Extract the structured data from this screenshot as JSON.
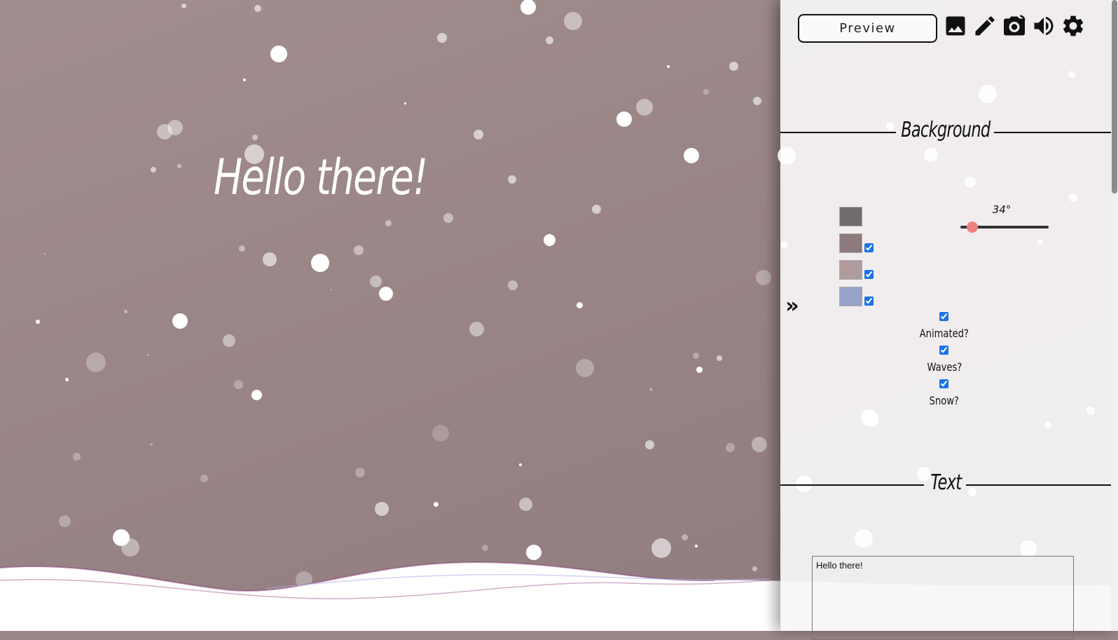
{
  "stage": {
    "greeting": "Hello there!"
  },
  "toolbar": {
    "preview_label": "Preview",
    "icons": [
      "image-icon",
      "pencil-icon",
      "camera-icon",
      "volume-icon",
      "gear-icon"
    ]
  },
  "background_section": {
    "title": "Background",
    "colors": [
      {
        "hex": "#6f6b6e",
        "enabled": null
      },
      {
        "hex": "#8d7a7c",
        "enabled": true
      },
      {
        "hex": "#b09c9d",
        "enabled": true
      },
      {
        "hex": "#97a3c8",
        "enabled": true
      }
    ],
    "angle_label": "34°",
    "angle_value": 34,
    "options": [
      {
        "label": "Animated?",
        "checked": true
      },
      {
        "label": "Waves?",
        "checked": true
      },
      {
        "label": "Snow?",
        "checked": true
      }
    ]
  },
  "text_section": {
    "title": "Text",
    "text_value": "Hello there!"
  },
  "panel_toggle_glyph": "»",
  "colors": {
    "accent_thumb": "#f08080",
    "checkbox_accent": "#1a73e8"
  }
}
